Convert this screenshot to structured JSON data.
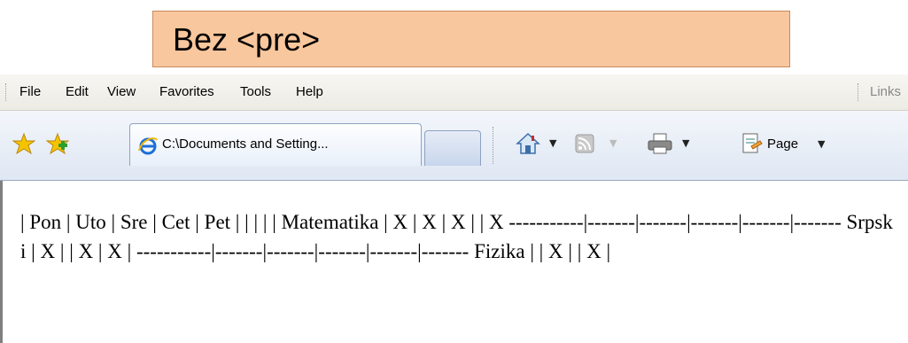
{
  "callout": {
    "text": "Bez <pre>"
  },
  "menu": {
    "items": [
      "File",
      "Edit",
      "View",
      "Favorites",
      "Tools",
      "Help"
    ],
    "links": "Links"
  },
  "toolbar": {
    "tab_title": "C:\\Documents and Setting...",
    "page_label": "Page",
    "icons": [
      "favorites-star-icon",
      "add-favorites-icon",
      "ie-logo-icon",
      "home-icon",
      "feeds-icon",
      "print-icon",
      "page-icon"
    ]
  },
  "content": {
    "text": "| Pon | Uto | Sre | Cet | Pet | | | | | Matematika | X | X | X | | X -----------|-------|-------|-------|-------|------- Srpski | X | | X | X | -----------|-------|-------|-------|-------|------- Fizika | | X | | X |"
  },
  "colors": {
    "callout_bg": "#f9c79d",
    "callout_border": "#c98a5c",
    "toolbar_bg": "#dfe7f3"
  }
}
